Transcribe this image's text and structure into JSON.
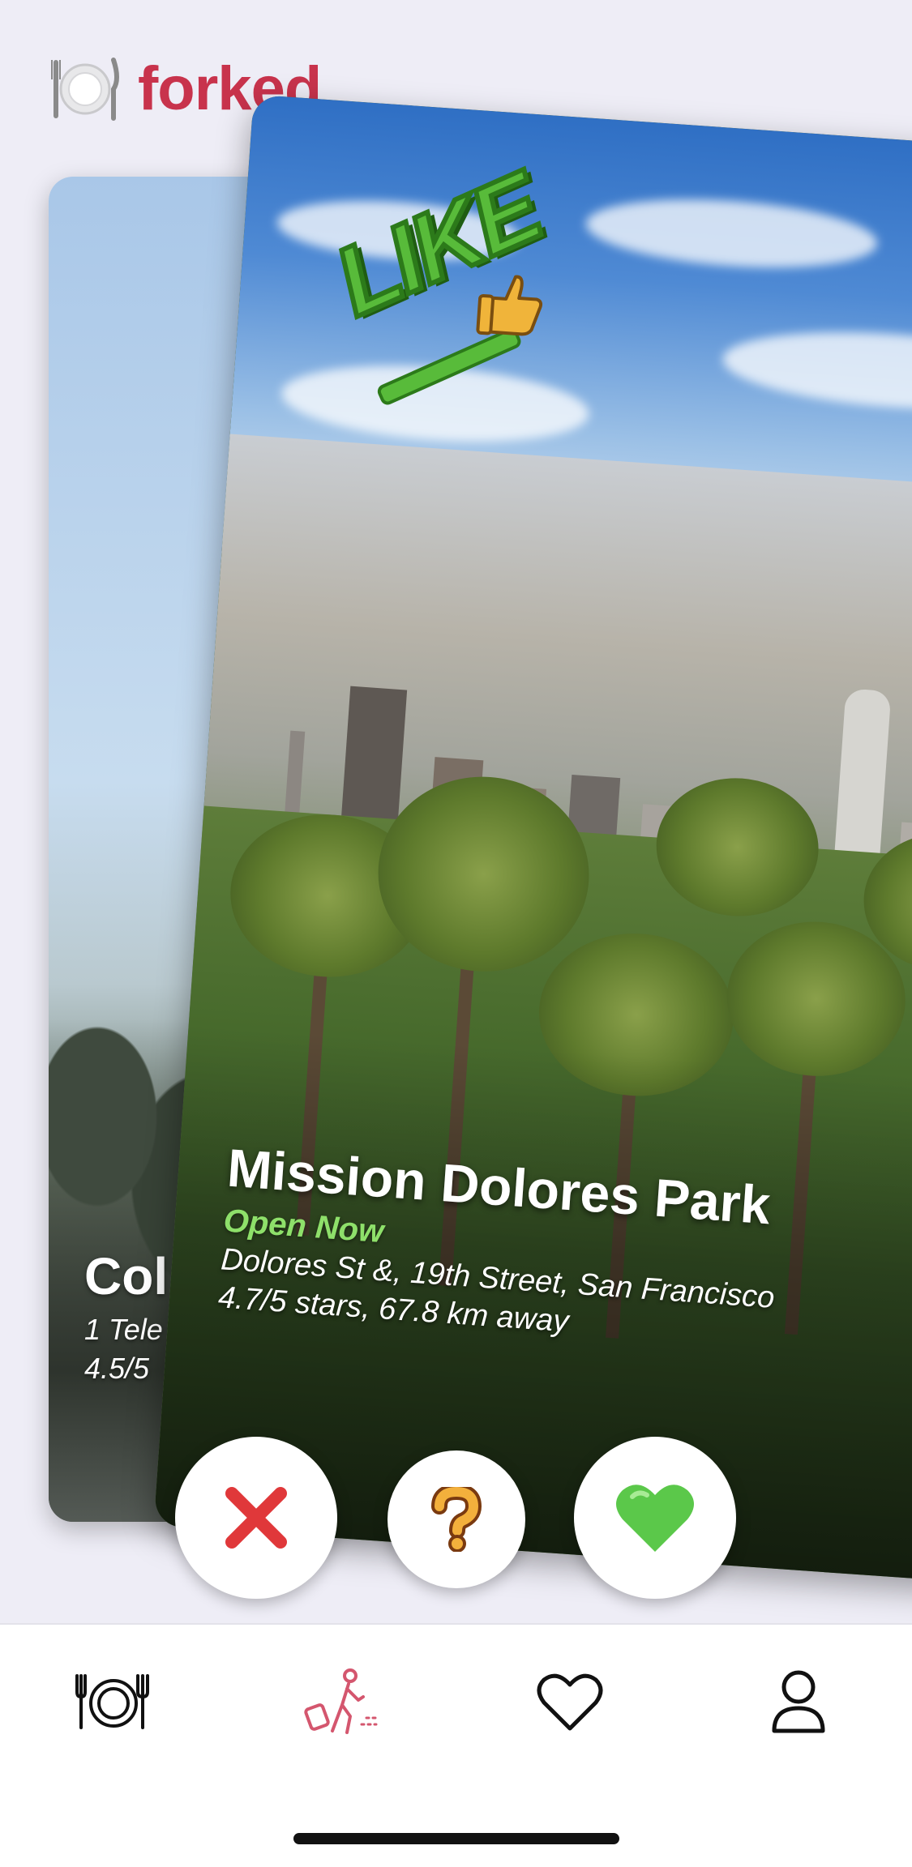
{
  "header": {
    "plate_icon": "plate-cutlery-icon",
    "brand": "forked",
    "brand_color": "#c8334c"
  },
  "back_card": {
    "title": "Col",
    "address": "1 Tele",
    "meta": "4.5/5"
  },
  "front_card": {
    "badge_text": "LIKE",
    "badge_icon": "thumbs-up-icon",
    "name": "Mission Dolores Park",
    "status": "Open Now",
    "status_color": "#8ee06a",
    "address": "Dolores St &, 19th Street, San Francisco",
    "meta": "4.7/5 stars, 67.8 km away"
  },
  "actions": {
    "dislike_icon": "cross-mark-icon",
    "maybe_icon": "question-mark-icon",
    "like_icon": "green-heart-icon"
  },
  "tabbar": {
    "items": [
      {
        "icon": "plate-cutlery-icon",
        "active": false
      },
      {
        "icon": "traveler-icon",
        "active": true
      },
      {
        "icon": "heart-icon",
        "active": false
      },
      {
        "icon": "profile-icon",
        "active": false
      }
    ],
    "active_color": "#d4566e",
    "inactive_color": "#111111"
  }
}
